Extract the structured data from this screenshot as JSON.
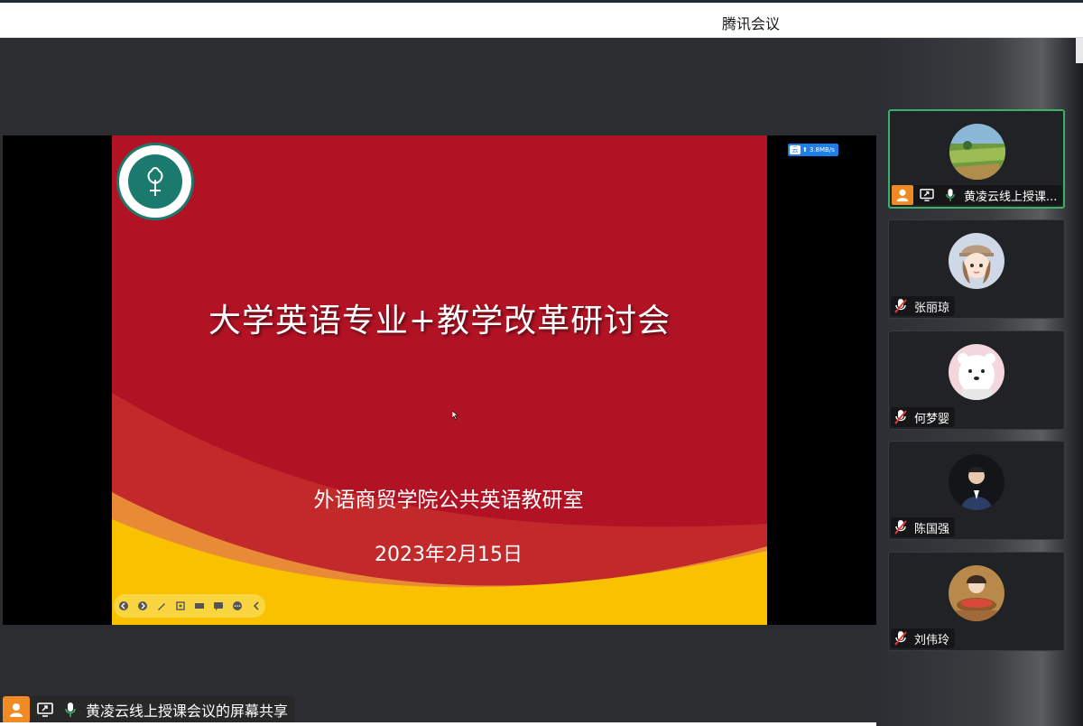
{
  "window": {
    "title": "腾讯会议"
  },
  "slide": {
    "title": "大学英语专业+教学改革研讨会",
    "subtitle": "外语商贸学院公共英语教研室",
    "date": "2023年2月15日"
  },
  "network_badge": {
    "speed": "3.8MB/s",
    "cloud_icon": "云"
  },
  "sharer": {
    "label": "黄凌云线上授课会议的屏幕共享"
  },
  "participants": [
    {
      "name": "黄凌云线上授课...",
      "avatar": "landscape-avatar",
      "host": true,
      "sharing": true,
      "mic": "on"
    },
    {
      "name": "张丽琼",
      "avatar": "girl-cap-avatar",
      "host": false,
      "sharing": false,
      "mic": "muted"
    },
    {
      "name": "何梦婴",
      "avatar": "bear-avatar",
      "host": false,
      "sharing": false,
      "mic": "muted"
    },
    {
      "name": "陈国强",
      "avatar": "man-suit-avatar",
      "host": false,
      "sharing": false,
      "mic": "muted"
    },
    {
      "name": "刘伟玲",
      "avatar": "woman-food-avatar",
      "host": false,
      "sharing": false,
      "mic": "muted"
    }
  ],
  "colors": {
    "slide_red": "#b21324",
    "slide_yellow": "#f9c100",
    "active_border": "#3ab06a",
    "host_orange": "#f08a24"
  }
}
